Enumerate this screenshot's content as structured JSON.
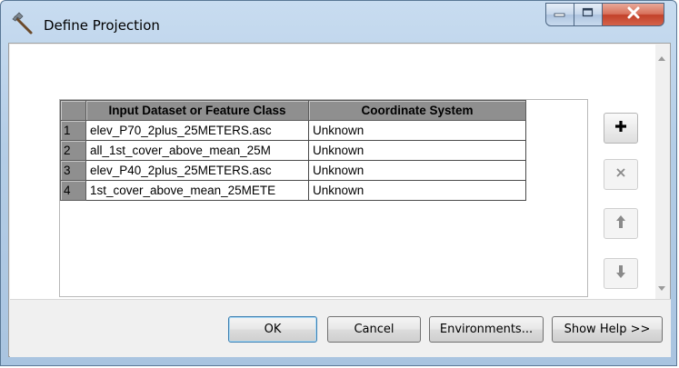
{
  "window": {
    "title": "Define Projection"
  },
  "table": {
    "headers": [
      "",
      "Input Dataset or Feature Class",
      "Coordinate System"
    ],
    "rows": [
      {
        "num": "1",
        "input": "elev_P70_2plus_25METERS.asc",
        "coord": "Unknown"
      },
      {
        "num": "2",
        "input": "all_1st_cover_above_mean_25M",
        "coord": "Unknown"
      },
      {
        "num": "3",
        "input": "elev_P40_2plus_25METERS.asc",
        "coord": "Unknown"
      },
      {
        "num": "4",
        "input": "1st_cover_above_mean_25METE",
        "coord": "Unknown"
      }
    ]
  },
  "side_buttons": {
    "add": {
      "icon": "plus-icon",
      "enabled": true
    },
    "remove": {
      "icon": "x-icon",
      "enabled": false
    },
    "move_up": {
      "icon": "arrow-up-icon",
      "enabled": false
    },
    "move_down": {
      "icon": "arrow-down-icon",
      "enabled": false
    }
  },
  "buttons": {
    "ok": "OK",
    "cancel": "Cancel",
    "environments": "Environments...",
    "show_help": "Show Help >>"
  },
  "colors": {
    "title_bar": "#b4cde6",
    "close_button": "#c2412a",
    "grid_header": "#8f8f8f"
  }
}
